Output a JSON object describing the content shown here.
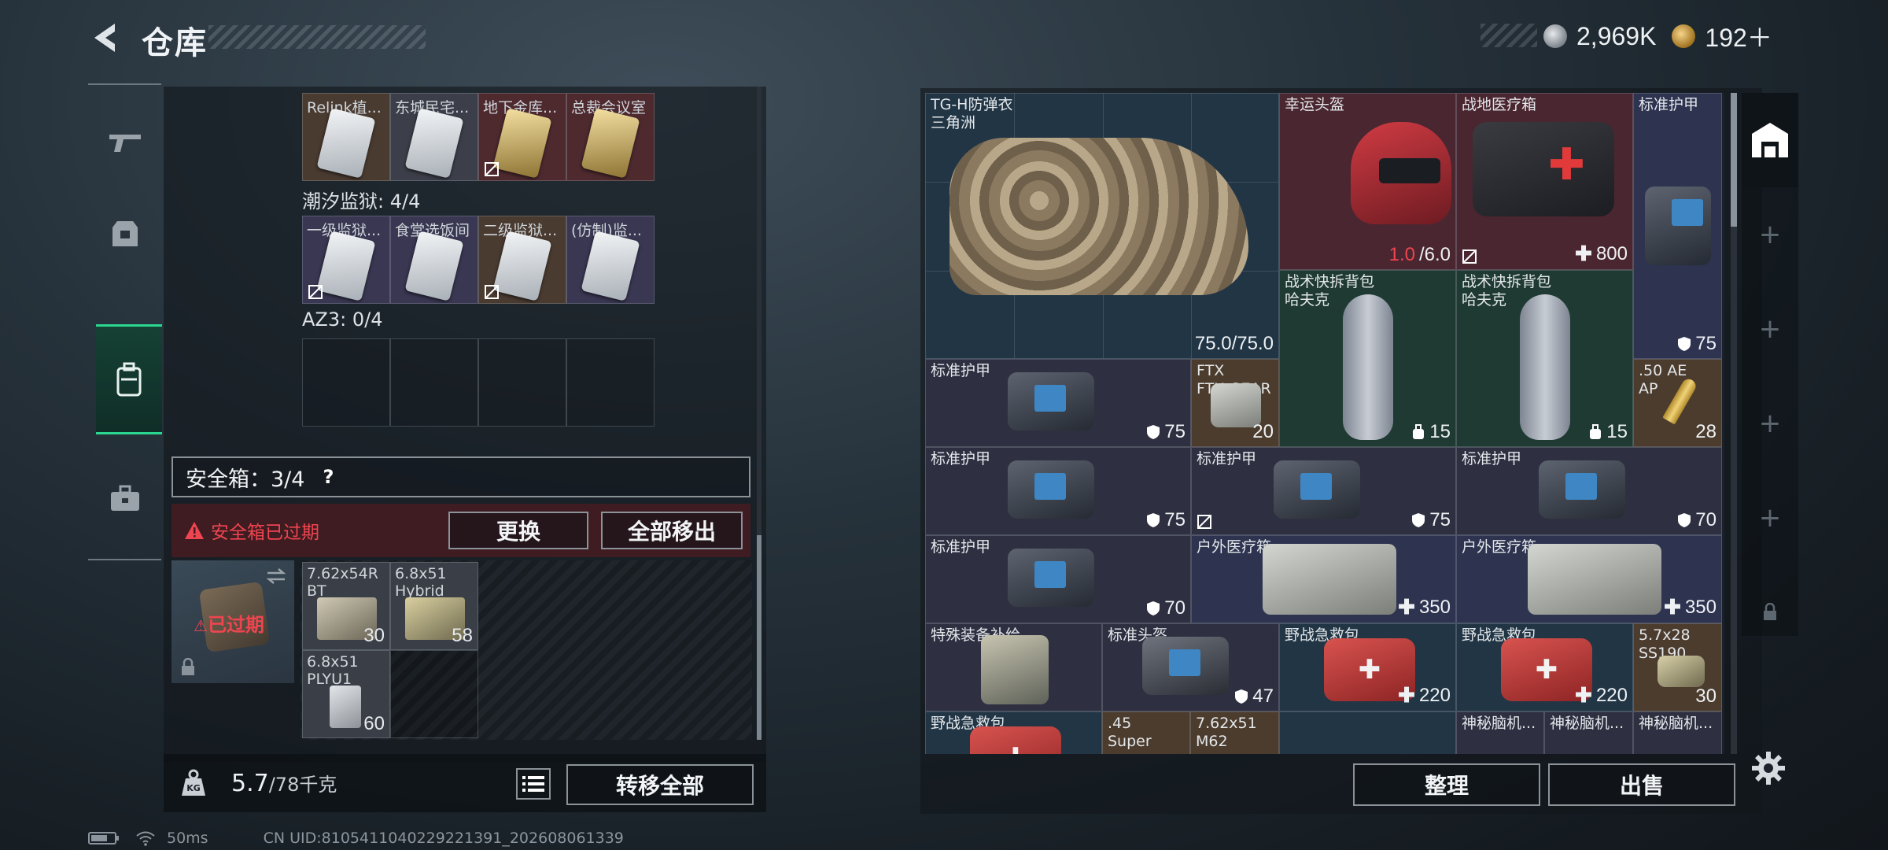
{
  "header": {
    "title": "仓库"
  },
  "currency": [
    {
      "value": "2,969K",
      "color": "silver"
    },
    {
      "value": "192＋",
      "color": "gold"
    }
  ],
  "nav": [
    "gun-icon",
    "armor-icon",
    "backpack-icon",
    "toolbox-icon"
  ],
  "left": {
    "row1": [
      {
        "name": "Relink植...",
        "bg": "brown",
        "card": "silver",
        "nosell": false
      },
      {
        "name": "东城民宅...",
        "bg": "gray",
        "card": "silver",
        "nosell": false
      },
      {
        "name": "地下金库...",
        "bg": "red",
        "card": "gold",
        "nosell": true
      },
      {
        "name": "总裁会议室",
        "bg": "red",
        "card": "gold",
        "nosell": false
      }
    ],
    "section2": "潮汐监狱: 4/4",
    "row2": [
      {
        "name": "一级监狱...",
        "bg": "purple",
        "card": "silver",
        "nosell": true
      },
      {
        "name": "食堂选饭间",
        "bg": "purple",
        "card": "silver",
        "nosell": false
      },
      {
        "name": "二级监狱...",
        "bg": "brown",
        "card": "silver",
        "nosell": true
      },
      {
        "name": "(仿制)监...",
        "bg": "purple",
        "card": "silver",
        "nosell": false
      }
    ],
    "section3": "AZ3: 0/4",
    "safe_label": "安全箱：3/4",
    "safe_help": "?",
    "warning": "安全箱已过期",
    "btn_replace": "更换",
    "btn_move_all": "全部移出",
    "expired_tag": "已过期",
    "safe_items": [
      {
        "name": "7.62x54R\nBT",
        "count": "30"
      },
      {
        "name": "6.8x51\nHybrid",
        "count": "58"
      },
      {
        "name": "6.8x51\nPLYU1",
        "count": "60"
      }
    ],
    "weight_value": "5.7",
    "weight_max": "/78千克",
    "btn_transfer_all": "转移全部"
  },
  "status": {
    "ping": "50ms",
    "uid": "CN UID:8105411040229221391_202608061339"
  },
  "right": {
    "items": [
      {
        "key": "vest",
        "name": "TG-H防弹衣\n三角洲",
        "value": "75.0/75.0"
      },
      {
        "key": "helmet",
        "name": "幸运头盔",
        "value_red": "1.0",
        "value": "/6.0"
      },
      {
        "key": "medbag",
        "name": "战地医疗箱",
        "value": "800"
      },
      {
        "key": "armor1",
        "name": "标准护甲",
        "value": "75"
      },
      {
        "key": "bag1",
        "name": "战术快拆背包\n哈夫克",
        "value": "15"
      },
      {
        "key": "bag2",
        "name": "战术快拆背包\n哈夫克",
        "value": "15"
      },
      {
        "key": "armor2",
        "name": "标准护甲",
        "value": "75"
      },
      {
        "key": "ftx",
        "name": "FTX\nFTX-GEAR",
        "value": "20"
      },
      {
        "key": "ae50",
        "name": ".50 AE\nAP",
        "value": "28"
      },
      {
        "key": "armor3",
        "name": "标准护甲",
        "value": "75"
      },
      {
        "key": "armor4",
        "name": "标准护甲",
        "value": "75"
      },
      {
        "key": "armor5",
        "name": "标准护甲",
        "value": "70"
      },
      {
        "key": "armor6",
        "name": "标准护甲",
        "value": "70"
      },
      {
        "key": "outmed1",
        "name": "户外医疗箱",
        "value": "350"
      },
      {
        "key": "outmed2",
        "name": "户外医疗箱",
        "value": "350"
      },
      {
        "key": "special",
        "name": "特殊装备补给"
      },
      {
        "key": "helmet2",
        "name": "标准头盔",
        "value": "47"
      },
      {
        "key": "field1",
        "name": "野战急救包",
        "value": "220"
      },
      {
        "key": "field2",
        "name": "野战急救包",
        "value": "220"
      },
      {
        "key": "ss190",
        "name": "5.7x28\nSS190",
        "value": "30"
      },
      {
        "key": "field3",
        "name": "野战急救包"
      },
      {
        "key": "super45",
        "name": ".45\nSuper"
      },
      {
        "key": "m62",
        "name": "7.62x51\nM62"
      },
      {
        "key": "myst1",
        "name": "神秘脑机..."
      },
      {
        "key": "myst2",
        "name": "神秘脑机..."
      },
      {
        "key": "myst3",
        "name": "神秘脑机..."
      }
    ],
    "btn_sort": "整理",
    "btn_sell": "出售"
  }
}
